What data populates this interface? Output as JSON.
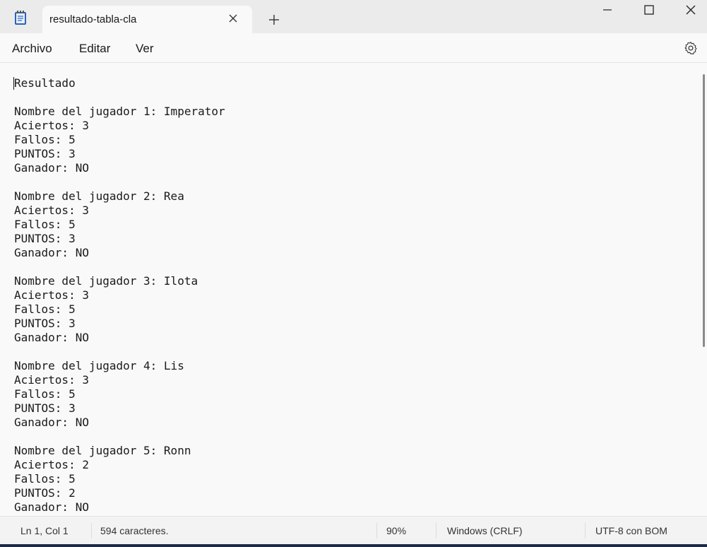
{
  "window": {
    "tab_title": "resultado-tabla-cla"
  },
  "menu": {
    "items": [
      "Archivo",
      "Editar",
      "Ver"
    ]
  },
  "editor": {
    "content": "Resultado\n\nNombre del jugador 1: Imperator\nAciertos: 3\nFallos: 5\nPUNTOS: 3\nGanador: NO\n\nNombre del jugador 2: Rea\nAciertos: 3\nFallos: 5\nPUNTOS: 3\nGanador: NO\n\nNombre del jugador 3: Ilota\nAciertos: 3\nFallos: 5\nPUNTOS: 3\nGanador: NO\n\nNombre del jugador 4: Lis\nAciertos: 3\nFallos: 5\nPUNTOS: 3\nGanador: NO\n\nNombre del jugador 5: Ronn\nAciertos: 2\nFallos: 5\nPUNTOS: 2\nGanador: NO"
  },
  "status": {
    "position": "Ln 1, Col 1",
    "characters": "594 caracteres.",
    "zoom": "90%",
    "line_ending": "Windows (CRLF)",
    "encoding": "UTF-8 con BOM"
  },
  "icons": {
    "app": "notepad-icon",
    "tab_close": "close-icon",
    "new_tab": "plus-icon",
    "minimize": "minimize-icon",
    "maximize": "maximize-icon",
    "close": "close-icon",
    "settings": "gear-icon"
  },
  "colors": {
    "titlebar": "#ebebeb",
    "background": "#f9f9f9",
    "statusbar": "#f3f3f3",
    "app_icon_blue": "#2b63b8"
  }
}
